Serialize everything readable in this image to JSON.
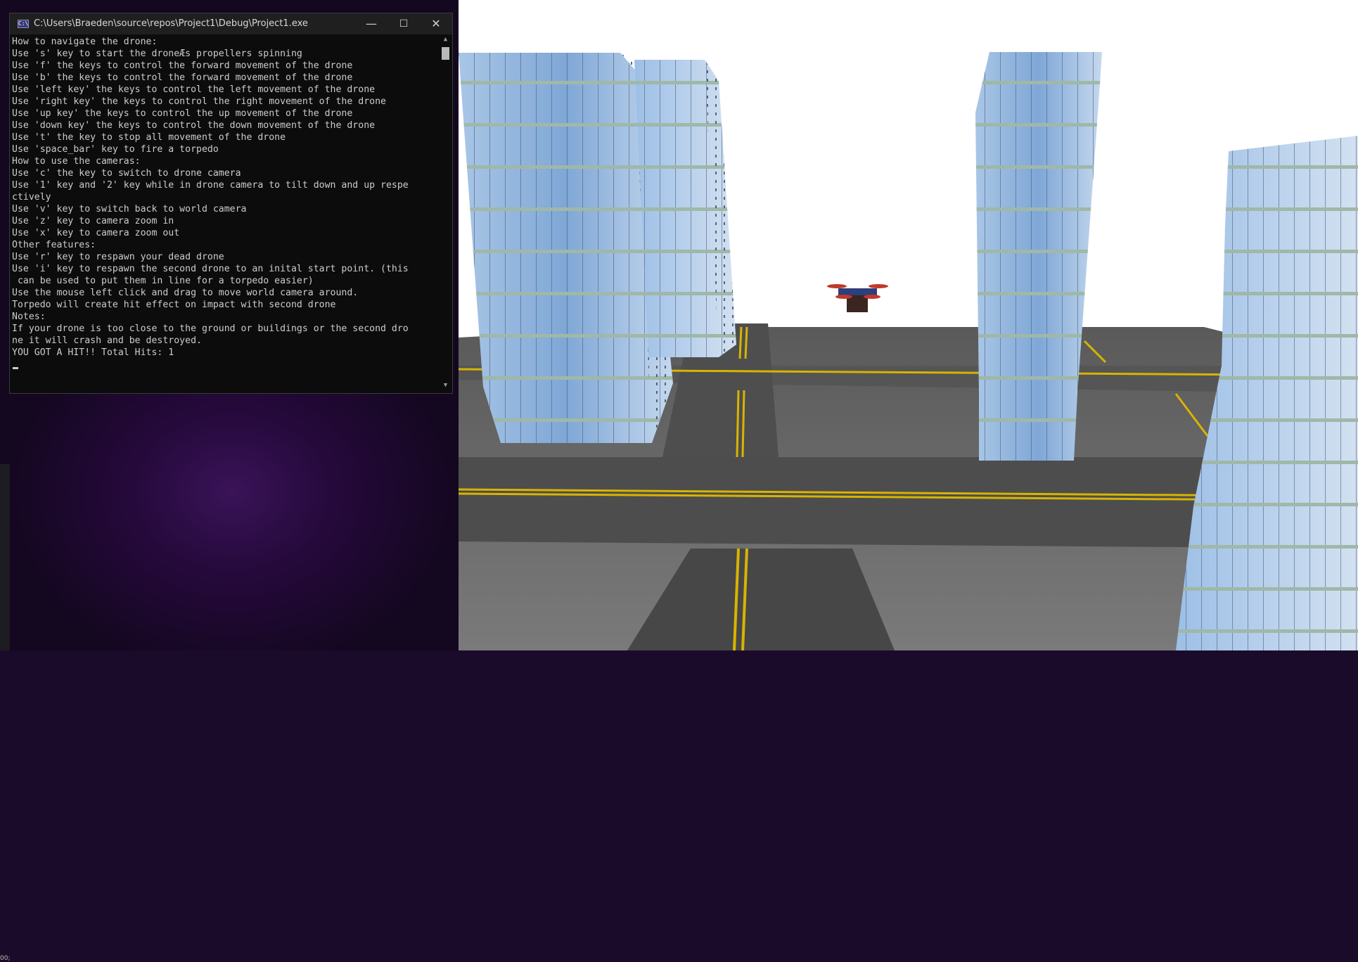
{
  "console": {
    "title": "C:\\Users\\Braeden\\source\\repos\\Project1\\Debug\\Project1.exe",
    "icon": "console-app-icon",
    "controls": {
      "minimize": "—",
      "maximize": "☐",
      "close": "✕"
    },
    "lines": [
      "How to navigate the drone:",
      "Use 's' key to start the droneÆs propellers spinning",
      "Use 'f' the keys to control the forward movement of the drone",
      "Use 'b' the keys to control the forward movement of the drone",
      "Use 'left key' the keys to control the left movement of the drone",
      "Use 'right key' the keys to control the right movement of the drone",
      "Use 'up key' the keys to control the up movement of the drone",
      "Use 'down key' the keys to control the down movement of the drone",
      "Use 't' the key to stop all movement of the drone",
      "Use 'space_bar' key to fire a torpedo",
      "How to use the cameras:",
      "Use 'c' the key to switch to drone camera",
      "Use '1' key and '2' key while in drone camera to tilt down and up respe",
      "ctively",
      "Use 'v' key to switch back to world camera",
      "Use 'z' key to camera zoom in",
      "Use 'x' key to camera zoom out",
      "Other features:",
      "Use 'r' key to respawn your dead drone",
      "Use 'i' key to respawn the second drone to an inital start point. (this",
      " can be used to put them in line for a torpedo easier)",
      "Use the mouse left click and drag to move world camera around.",
      "Torpedo will create hit effect on impact with second drone",
      "Notes:",
      "If your drone is too close to the ground or buildings or the second dro",
      "ne it will crash and be destroyed.",
      "YOU GOT A HIT!! Total Hits: 1"
    ]
  },
  "desktop": {
    "edge_text": "00;"
  },
  "scene": {
    "sky_color": "#ffffff",
    "road_color": "#4a4a4a",
    "ground_color": "#6b6b6b",
    "line_color": "#d8b400",
    "glass_color": "#8fb4dc",
    "band_color": "#9fb8a8"
  }
}
